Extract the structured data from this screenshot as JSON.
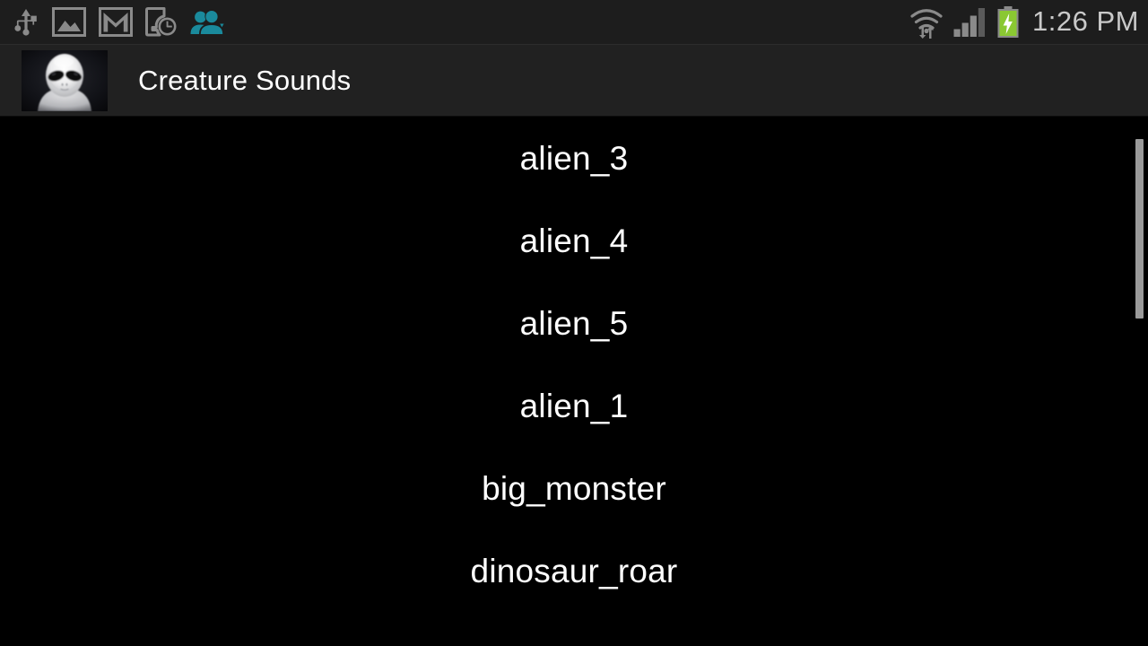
{
  "status_bar": {
    "notification_icons": [
      {
        "name": "usb-icon",
        "label": "USB connected"
      },
      {
        "name": "screenshot-icon",
        "label": "Screenshot captured"
      },
      {
        "name": "gmail-icon",
        "label": "New mail"
      },
      {
        "name": "phone-clock-icon",
        "label": "Scheduled"
      },
      {
        "name": "contacts-icon",
        "label": "Contacts"
      }
    ],
    "system_icons": [
      {
        "name": "wifi-icon",
        "label": "Wi-Fi connected"
      },
      {
        "name": "cellular-signal-icon",
        "label": "Cellular signal"
      },
      {
        "name": "battery-charging-icon",
        "label": "Battery charging"
      }
    ],
    "clock": "1:26 PM",
    "background_color": "#1d1d1d",
    "icon_color": "#8a8a8a",
    "accent_teal": "#1a8a9c",
    "battery_green": "#8ac832",
    "clock_color": "#c9c9c9"
  },
  "app_bar": {
    "icon_name": "alien-head-icon",
    "icon_alt": "Grey alien head",
    "title": "Creature Sounds",
    "background_color": "#212121",
    "title_color": "#ffffff"
  },
  "sound_list": {
    "background_color": "#000000",
    "text_color": "#ffffff",
    "items": [
      {
        "label": "alien_3"
      },
      {
        "label": "alien_4"
      },
      {
        "label": "alien_5"
      },
      {
        "label": "alien_1"
      },
      {
        "label": "big_monster"
      },
      {
        "label": "dinosaur_roar"
      }
    ]
  },
  "scrollbar": {
    "name": "vertical-scrollbar",
    "thumb_color": "#9a9a9a",
    "position": "right"
  }
}
